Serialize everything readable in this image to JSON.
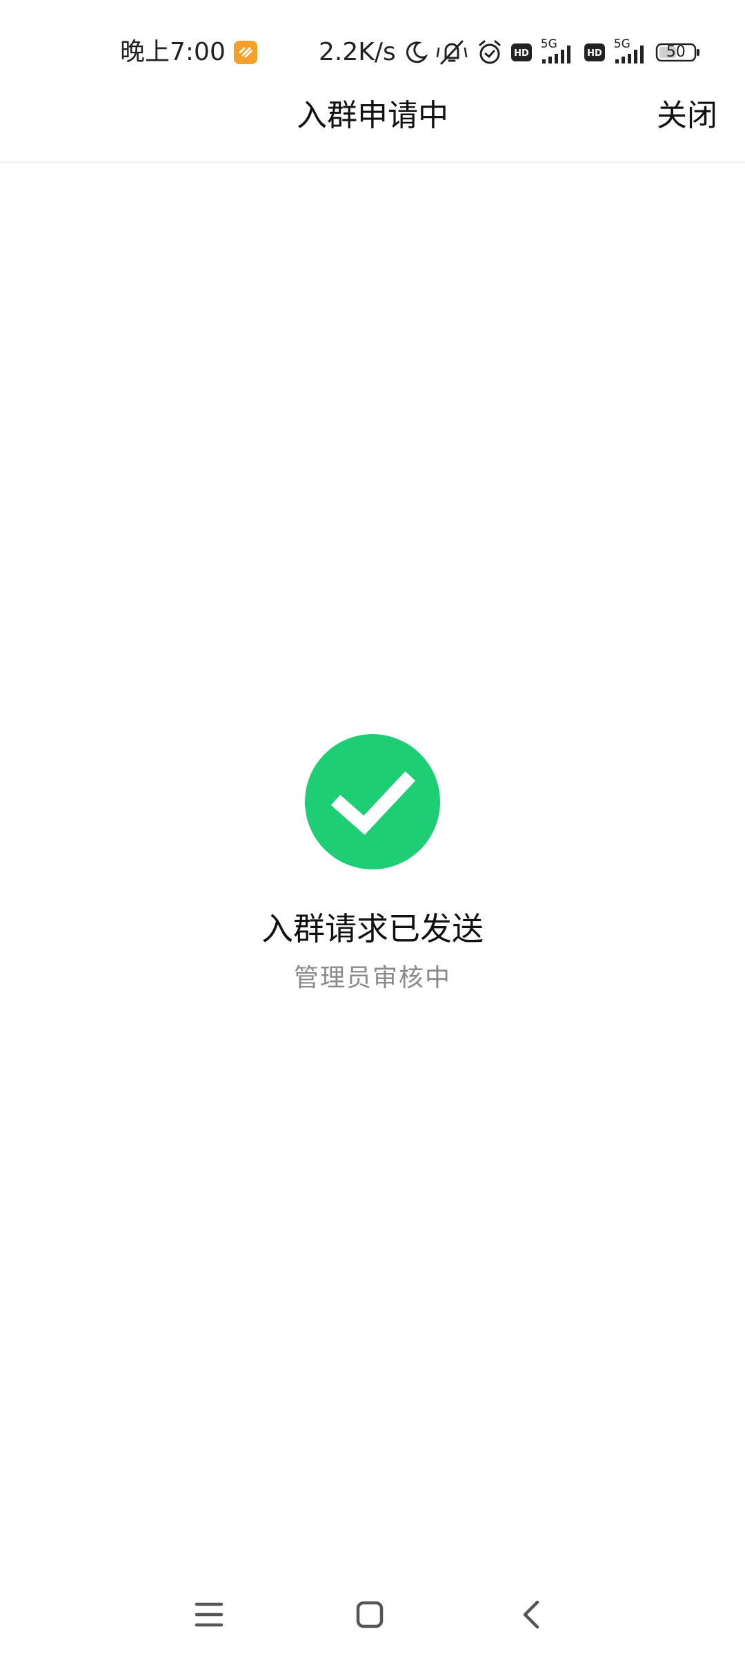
{
  "status_bar": {
    "time": "晚上7:00",
    "net_speed": "2.2K/s",
    "network_1": "5G",
    "network_2": "5G",
    "hd_label": "HD",
    "battery": "50",
    "icons": [
      "app-badge-icon",
      "moon-icon",
      "mute-bell-icon",
      "alarm-icon",
      "hd-icon",
      "signal-icon",
      "battery-icon"
    ]
  },
  "header": {
    "title": "入群申请中",
    "close_label": "关闭"
  },
  "result": {
    "title": "入群请求已发送",
    "subtitle": "管理员审核中",
    "icon": "check-circle-icon",
    "icon_color": "#1dce75"
  },
  "nav": {
    "icons": [
      "menu-icon",
      "home-icon",
      "back-icon"
    ]
  },
  "colors": {
    "accent": "#1dce75",
    "text_primary": "#111111",
    "text_secondary": "#8a8a8a",
    "badge": "#f6a02c"
  }
}
